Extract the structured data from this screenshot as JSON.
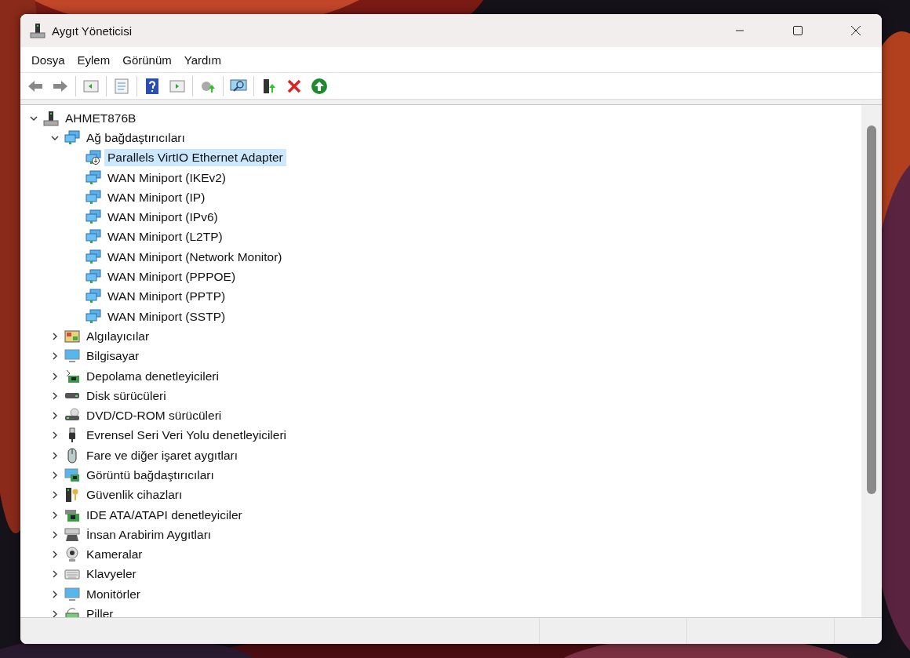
{
  "window": {
    "title": "Aygıt Yöneticisi"
  },
  "menu": [
    "Dosya",
    "Eylem",
    "Görünüm",
    "Yardım"
  ],
  "tree": {
    "label": "AHMET876B",
    "expanded": true,
    "selected": false,
    "children": [
      {
        "label": "Ağ bağdaştırıcıları",
        "expanded": true,
        "selected": false,
        "children": [
          {
            "label": "Parallels VirtIO Ethernet Adapter",
            "selected": true
          },
          {
            "label": "WAN Miniport (IKEv2)",
            "selected": false
          },
          {
            "label": "WAN Miniport (IP)",
            "selected": false
          },
          {
            "label": "WAN Miniport (IPv6)",
            "selected": false
          },
          {
            "label": "WAN Miniport (L2TP)",
            "selected": false
          },
          {
            "label": "WAN Miniport (Network Monitor)",
            "selected": false
          },
          {
            "label": "WAN Miniport (PPPOE)",
            "selected": false
          },
          {
            "label": "WAN Miniport (PPTP)",
            "selected": false
          },
          {
            "label": "WAN Miniport (SSTP)",
            "selected": false
          }
        ]
      },
      {
        "label": "Algılayıcılar",
        "expanded": false,
        "selected": false
      },
      {
        "label": "Bilgisayar",
        "expanded": false,
        "selected": false
      },
      {
        "label": "Depolama denetleyicileri",
        "expanded": false,
        "selected": false
      },
      {
        "label": "Disk sürücüleri",
        "expanded": false,
        "selected": false
      },
      {
        "label": "DVD/CD-ROM sürücüleri",
        "expanded": false,
        "selected": false
      },
      {
        "label": "Evrensel Seri Veri Yolu denetleyicileri",
        "expanded": false,
        "selected": false
      },
      {
        "label": "Fare ve diğer işaret aygıtları",
        "expanded": false,
        "selected": false
      },
      {
        "label": "Görüntü bağdaştırıcıları",
        "expanded": false,
        "selected": false
      },
      {
        "label": "Güvenlik cihazları",
        "expanded": false,
        "selected": false
      },
      {
        "label": "IDE ATA/ATAPI denetleyiciler",
        "expanded": false,
        "selected": false
      },
      {
        "label": "İnsan Arabirim Aygıtları",
        "expanded": false,
        "selected": false
      },
      {
        "label": "Kameralar",
        "expanded": false,
        "selected": false
      },
      {
        "label": "Klavyeler",
        "expanded": false,
        "selected": false
      },
      {
        "label": "Monitörler",
        "expanded": false,
        "selected": false
      },
      {
        "label": "Piller",
        "expanded": false,
        "selected": false
      }
    ]
  }
}
